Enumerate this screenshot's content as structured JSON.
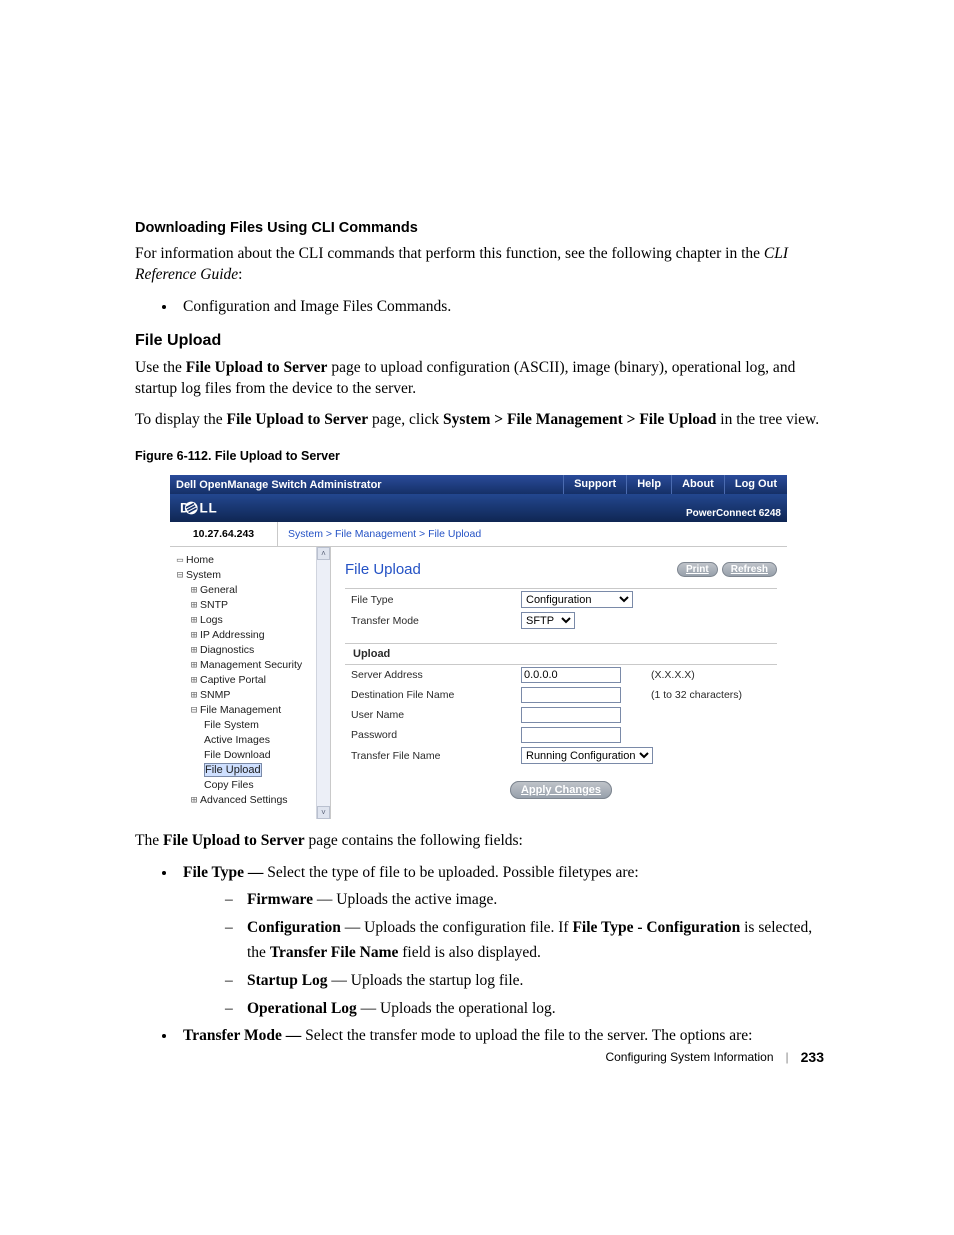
{
  "heading_cli": "Downloading Files Using CLI Commands",
  "para_cli_1a": "For information about the CLI commands that perform this function, see the following chapter in the ",
  "para_cli_1b": "CLI Reference Guide",
  "para_cli_1c": ":",
  "bullet_cli_1": "Configuration and Image Files Commands.",
  "heading_fu": "File Upload",
  "para_fu_1a": "Use the ",
  "para_fu_1b": "File Upload to Server",
  "para_fu_1c": " page to upload configuration (ASCII), image (binary), operational log, and startup log files from the device to the server.",
  "para_fu_2a": "To display the ",
  "para_fu_2b": "File Upload to Server",
  "para_fu_2c": " page, click ",
  "para_fu_2d": "System > File Management > File Upload",
  "para_fu_2e": " in the tree view.",
  "figcap": "Figure 6-112.    File Upload to Server",
  "shot": {
    "titlebar": {
      "title": "Dell OpenManage Switch Administrator",
      "links": [
        "Support",
        "Help",
        "About",
        "Log Out"
      ]
    },
    "model": "PowerConnect 6248",
    "ip": "10.27.64.243",
    "crumbs": "System > File Management > File Upload",
    "tree": {
      "home": "Home",
      "system": "System",
      "items": [
        "General",
        "SNTP",
        "Logs",
        "IP Addressing",
        "Diagnostics",
        "Management Security",
        "Captive Portal",
        "SNMP"
      ],
      "filemgmt": "File Management",
      "fm_children": [
        "File System",
        "Active Images",
        "File Download",
        "File Upload",
        "Copy Files"
      ],
      "adv": "Advanced Settings"
    },
    "page": {
      "title": "File Upload",
      "print": "Print",
      "refresh": "Refresh",
      "section1": {
        "filetype_lbl": "File Type",
        "filetype_val": "Configuration",
        "transfermode_lbl": "Transfer Mode",
        "transfermode_val": "SFTP"
      },
      "section_upload": "Upload",
      "section2": {
        "server_lbl": "Server Address",
        "server_val": "0.0.0.0",
        "server_hint": "(X.X.X.X)",
        "dest_lbl": "Destination File Name",
        "dest_val": "",
        "dest_hint": "(1 to 32 characters)",
        "user_lbl": "User Name",
        "user_val": "",
        "pass_lbl": "Password",
        "pass_val": "",
        "tname_lbl": "Transfer File Name",
        "tname_val": "Running Configuration"
      },
      "apply": "Apply Changes"
    }
  },
  "after_para_1a": "The ",
  "after_para_1b": "File Upload to Server",
  "after_para_1c": " page contains the following fields:",
  "b_filetype_a": "File Type — ",
  "b_filetype_b": "Select the type of file to be uploaded. Possible filetypes are:",
  "d_firmware_a": "Firmware",
  "d_firmware_b": " — Uploads the active image.",
  "d_config_a": "Configuration",
  "d_config_b": " — Uploads the configuration file. If ",
  "d_config_c": "File Type - Configuration",
  "d_config_d": " is selected, the ",
  "d_config_e": "Transfer File Name",
  "d_config_f": " field is also displayed.",
  "d_startup_a": "Startup Log",
  "d_startup_b": " — Uploads the startup log file.",
  "d_oplog_a": "Operational Log",
  "d_oplog_b": " — Uploads the operational log.",
  "b_transfer_a": "Transfer Mode — ",
  "b_transfer_b": "Select the transfer mode to upload the file to the server. The options are:",
  "footer_section": "Configuring System Information",
  "footer_page": "233"
}
